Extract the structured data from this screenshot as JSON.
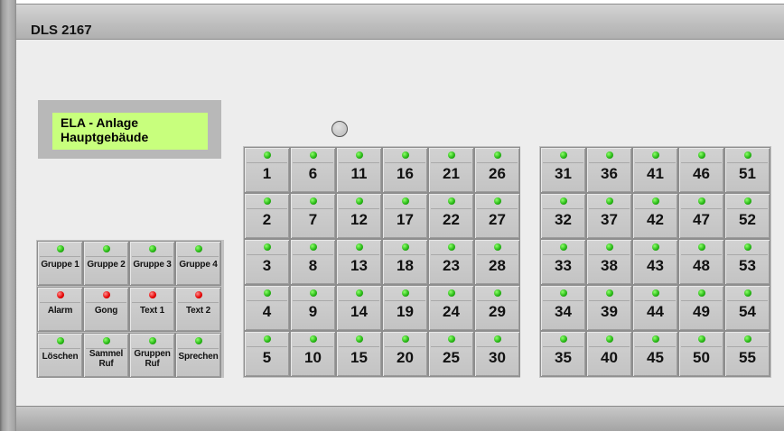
{
  "device": {
    "title": "DLS 2167"
  },
  "display": {
    "line1": "ELA - Anlage",
    "line2": "Hauptgebäude"
  },
  "colors": {
    "led_green": "#22b012",
    "led_red": "#e40000",
    "display_bg": "#c8ff7d",
    "panel_bg": "#ededed"
  },
  "control_buttons": [
    {
      "label": "Gruppe 1",
      "led": "green"
    },
    {
      "label": "Gruppe 2",
      "led": "green"
    },
    {
      "label": "Gruppe 3",
      "led": "green"
    },
    {
      "label": "Gruppe 4",
      "led": "green"
    },
    {
      "label": "Alarm",
      "led": "red"
    },
    {
      "label": "Gong",
      "led": "red"
    },
    {
      "label": "Text 1",
      "led": "red"
    },
    {
      "label": "Text 2",
      "led": "red"
    },
    {
      "label": "Löschen",
      "led": "green"
    },
    {
      "label": "Sammel\nRuf",
      "led": "green"
    },
    {
      "label": "Gruppen\nRuf",
      "led": "green"
    },
    {
      "label": "Sprechen",
      "led": "green"
    }
  ],
  "zone_buttons": [
    "1",
    "2",
    "3",
    "4",
    "5",
    "6",
    "7",
    "8",
    "9",
    "10",
    "11",
    "12",
    "13",
    "14",
    "15",
    "16",
    "17",
    "18",
    "19",
    "20",
    "21",
    "22",
    "23",
    "24",
    "25",
    "26",
    "27",
    "28",
    "29",
    "30",
    "31",
    "32",
    "33",
    "34",
    "35",
    "36",
    "37",
    "38",
    "39",
    "40",
    "41",
    "42",
    "43",
    "44",
    "45",
    "46",
    "47",
    "48",
    "49",
    "50",
    "51",
    "52",
    "53",
    "54",
    "55"
  ]
}
